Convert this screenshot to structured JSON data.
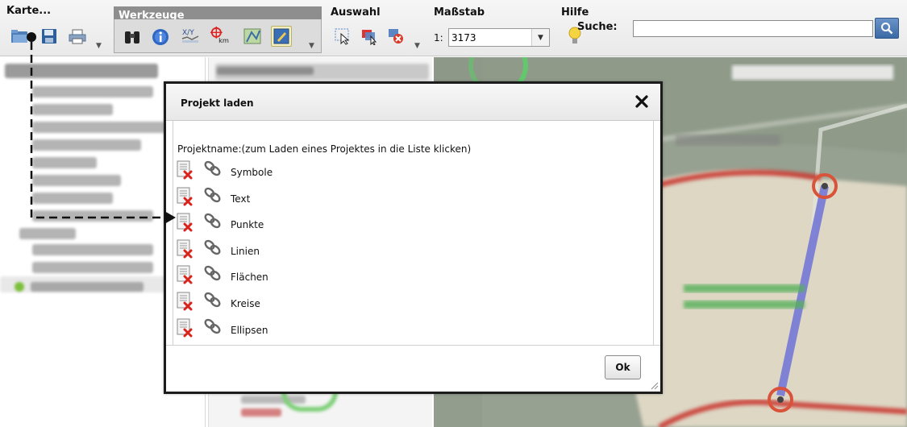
{
  "toolbar": {
    "groups": {
      "map": "Karte...",
      "tools": "Werkzeuge",
      "selection": "Auswahl",
      "scale": "Maßstab",
      "help": "Hilfe"
    },
    "scale_prefix": "1:",
    "scale_value": "3173",
    "search_label": "Suche:",
    "search_value": "",
    "icons": {
      "open": "folder-open-icon",
      "save": "save-icon",
      "print": "print-icon",
      "find": "binoculars-icon",
      "info": "info-icon",
      "coords": "coordinates-icon",
      "distance": "distance-km-icon",
      "legend": "legend-icon",
      "edit": "edit-icon",
      "select": "select-pointer-icon",
      "select_area": "select-area-icon",
      "deselect": "deselect-icon",
      "help": "help-bulb-icon",
      "search": "magnifier-icon"
    }
  },
  "dialog": {
    "title": "Projekt laden",
    "instruction": "Projektname:(zum Laden eines Projektes in die Liste klicken)",
    "projects": [
      {
        "name": "Symbole"
      },
      {
        "name": "Text"
      },
      {
        "name": "Punkte"
      },
      {
        "name": "Linien"
      },
      {
        "name": "Flächen"
      },
      {
        "name": "Kreise"
      },
      {
        "name": "Ellipsen"
      }
    ],
    "ok_label": "Ok"
  },
  "colors": {
    "accent_blue": "#3b6aa6",
    "delete_red": "#d9241e",
    "dialog_border": "#1c1c1c"
  }
}
